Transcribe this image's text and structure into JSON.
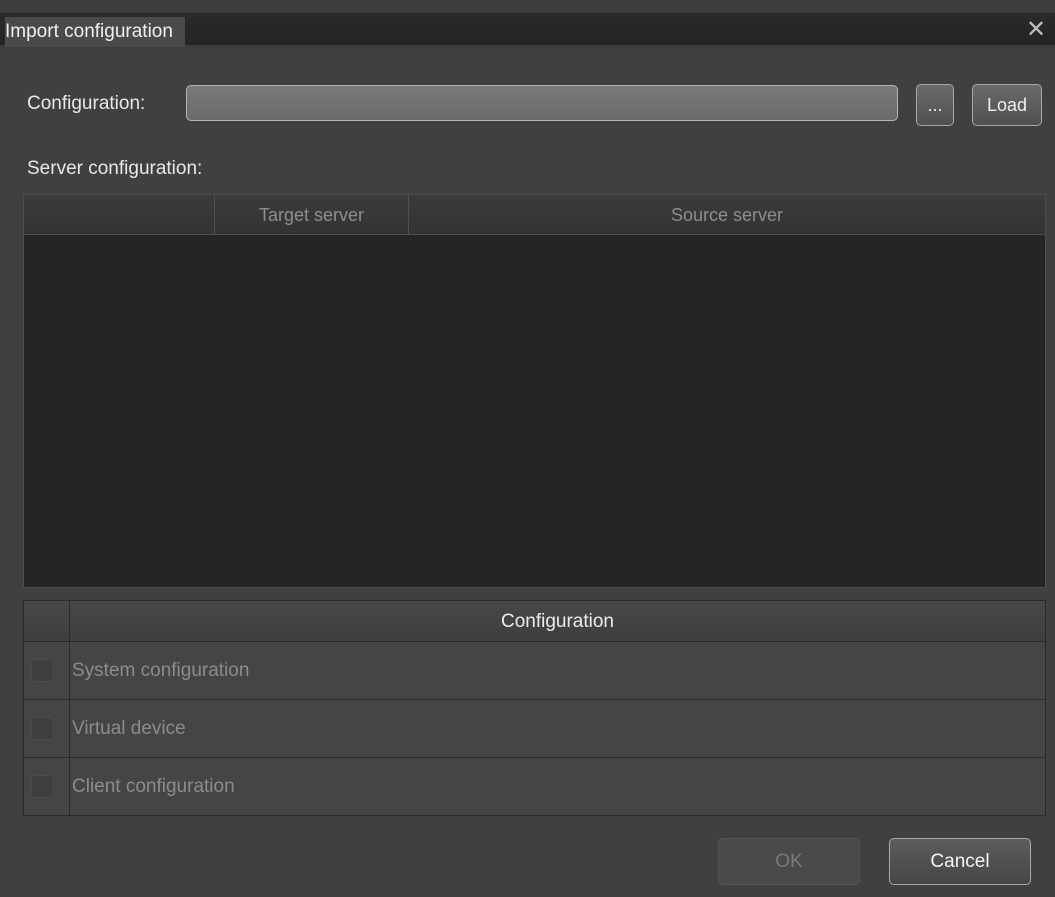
{
  "dialog": {
    "title": "Import configuration",
    "close_icon": "close-icon",
    "close_glyph": "✕"
  },
  "configuration_row": {
    "label": "Configuration:",
    "value": "",
    "browse_label": "...",
    "load_label": "Load"
  },
  "server_configuration": {
    "label": "Server configuration:",
    "columns": [
      "",
      "Target server",
      "Source server"
    ],
    "rows": []
  },
  "configuration_table": {
    "header": "Configuration",
    "rows": [
      {
        "label": "System configuration",
        "checked": false
      },
      {
        "label": "Virtual device",
        "checked": false
      },
      {
        "label": "Client configuration",
        "checked": false
      }
    ]
  },
  "footer": {
    "ok_label": "OK",
    "cancel_label": "Cancel",
    "ok_enabled": false
  }
}
